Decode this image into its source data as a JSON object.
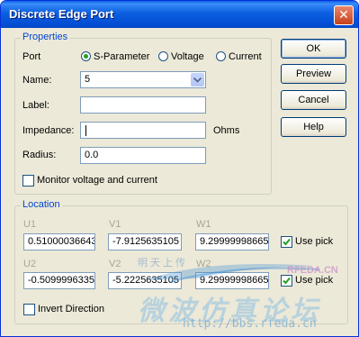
{
  "window": {
    "title": "Discrete Edge Port"
  },
  "properties": {
    "group_label": "Properties",
    "port_label": "Port",
    "port_options": [
      "S-Parameter",
      "Voltage",
      "Current"
    ],
    "port_selected": "S-Parameter",
    "name_label": "Name:",
    "name_value": "5",
    "label_label": "Label:",
    "label_value": "",
    "impedance_label": "Impedance:",
    "impedance_value": "",
    "impedance_unit": "Ohms",
    "radius_label": "Radius:",
    "radius_value": "0.0",
    "monitor_label": "Monitor voltage and current",
    "monitor_checked": false
  },
  "buttons": {
    "ok": "OK",
    "preview": "Preview",
    "cancel": "Cancel",
    "help": "Help"
  },
  "location": {
    "group_label": "Location",
    "row1": {
      "u_label": "U1",
      "v_label": "V1",
      "w_label": "W1",
      "u": "0.51000036643",
      "v": "-7.9125635105",
      "w": "9.29999998665",
      "use_pick": "Use pick",
      "use_pick_checked": true
    },
    "row2": {
      "u_label": "U2",
      "v_label": "V2",
      "w_label": "W2",
      "u": "-0.5099996335",
      "v": "-5.2225635105",
      "w": "9.29999998665",
      "use_pick": "Use pick",
      "use_pick_checked": true
    },
    "invert_label": "Invert Direction",
    "invert_checked": false
  },
  "watermark": {
    "site_cn": "微波仿真论坛",
    "url": "http://bbs.rfeda.cn",
    "brand": "RFEDA.CN",
    "small_cn": "明天上传"
  },
  "colors": {
    "accent": "#0046d5",
    "title_bar": "#0a5ee8",
    "check_mark": "#21a121"
  }
}
